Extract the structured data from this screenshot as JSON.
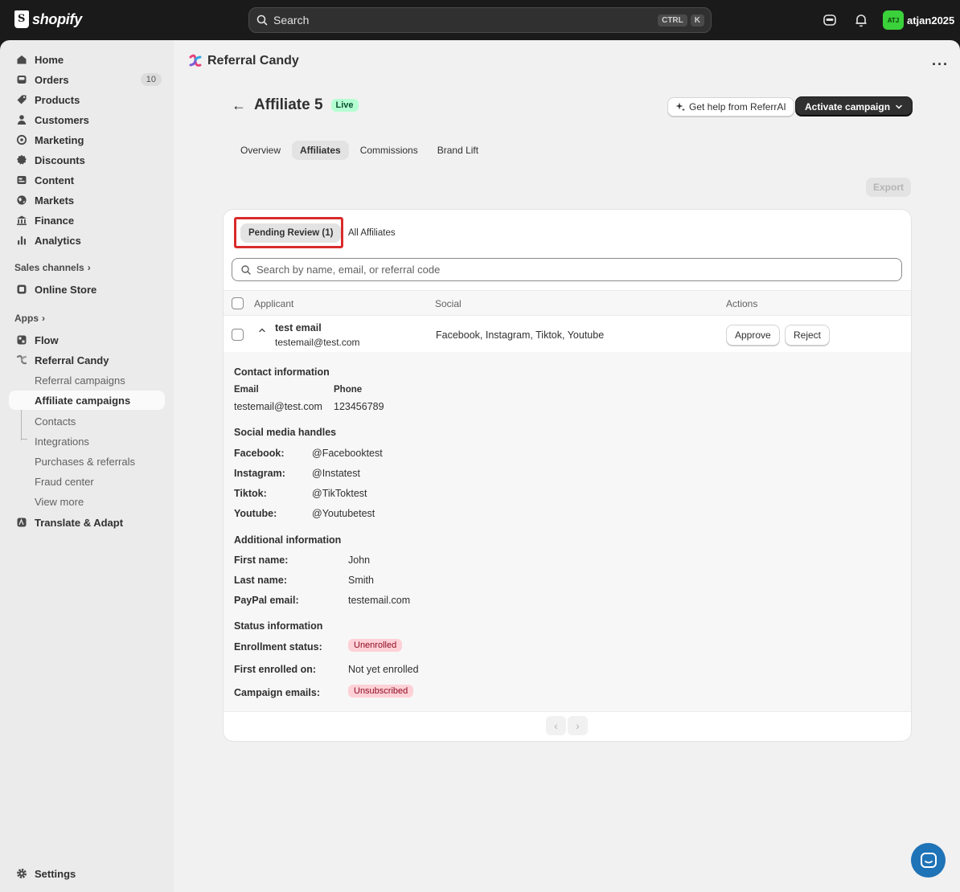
{
  "topbar": {
    "brand": "shopify",
    "search_placeholder": "Search",
    "shortcut_keys": [
      "CTRL",
      "K"
    ],
    "user_initials": "ATJ",
    "user_name": "atjan2025",
    "avatar_color": "#3bd13b"
  },
  "sidebar": {
    "main_items": [
      {
        "label": "Home",
        "icon": "home-icon"
      },
      {
        "label": "Orders",
        "icon": "inbox-icon",
        "badge": "10"
      },
      {
        "label": "Products",
        "icon": "tag-icon"
      },
      {
        "label": "Customers",
        "icon": "person-icon"
      },
      {
        "label": "Marketing",
        "icon": "target-icon"
      },
      {
        "label": "Discounts",
        "icon": "discount-icon"
      },
      {
        "label": "Content",
        "icon": "image-icon"
      },
      {
        "label": "Markets",
        "icon": "globe-icon"
      },
      {
        "label": "Finance",
        "icon": "bank-icon"
      },
      {
        "label": "Analytics",
        "icon": "bar-chart-icon"
      }
    ],
    "sales_channels_label": "Sales channels",
    "online_store": "Online Store",
    "apps_label": "Apps",
    "flow": "Flow",
    "referral_candy": "Referral Candy",
    "sub_items": [
      "Referral campaigns",
      "Affiliate campaigns",
      "Contacts",
      "Integrations",
      "Purchases & referrals",
      "Fraud center",
      "View more"
    ],
    "translate": "Translate & Adapt",
    "settings": "Settings"
  },
  "app": {
    "title": "Referral Candy"
  },
  "page": {
    "title": "Affiliate 5",
    "status": "Live",
    "help_button": "Get help from ReferrAI",
    "activate_button": "Activate campaign",
    "tabs": [
      "Overview",
      "Affiliates",
      "Commissions",
      "Brand Lift"
    ],
    "active_tab": "Affiliates",
    "export_button": "Export"
  },
  "card": {
    "subtabs": [
      "Pending Review (1)",
      "All Affiliates"
    ],
    "search_placeholder": "Search by name, email, or referral code",
    "columns": [
      "Applicant",
      "Social",
      "Actions"
    ],
    "row": {
      "name": "test email",
      "email": "testemail@test.com",
      "social": "Facebook, Instagram, Tiktok, Youtube",
      "approve": "Approve",
      "reject": "Reject"
    },
    "details": {
      "contact_heading": "Contact information",
      "email_label": "Email",
      "email_value": "testemail@test.com",
      "phone_label": "Phone",
      "phone_value": "123456789",
      "social_heading": "Social media handles",
      "social": [
        {
          "label": "Facebook:",
          "value": "@Facebooktest"
        },
        {
          "label": "Instagram:",
          "value": "@Instatest"
        },
        {
          "label": "Tiktok:",
          "value": "@TikToktest"
        },
        {
          "label": "Youtube:",
          "value": "@Youtubetest"
        }
      ],
      "additional_heading": "Additional information",
      "additional": [
        {
          "label": "First name:",
          "value": "John"
        },
        {
          "label": "Last name:",
          "value": "Smith"
        },
        {
          "label": "PayPal email:",
          "value": "testemail.com"
        }
      ],
      "status_heading": "Status information",
      "enrollment_label": "Enrollment status:",
      "enrollment_value": "Unenrolled",
      "first_enrolled_label": "First enrolled on:",
      "first_enrolled_value": "Not yet enrolled",
      "campaign_emails_label": "Campaign emails:",
      "campaign_emails_value": "Unsubscribed"
    }
  },
  "colors": {
    "live_badge_bg": "#b4fed2",
    "danger_pill_bg": "#fed1d7",
    "highlight_border": "#d92b2b",
    "chat_button": "#1f73b7"
  }
}
